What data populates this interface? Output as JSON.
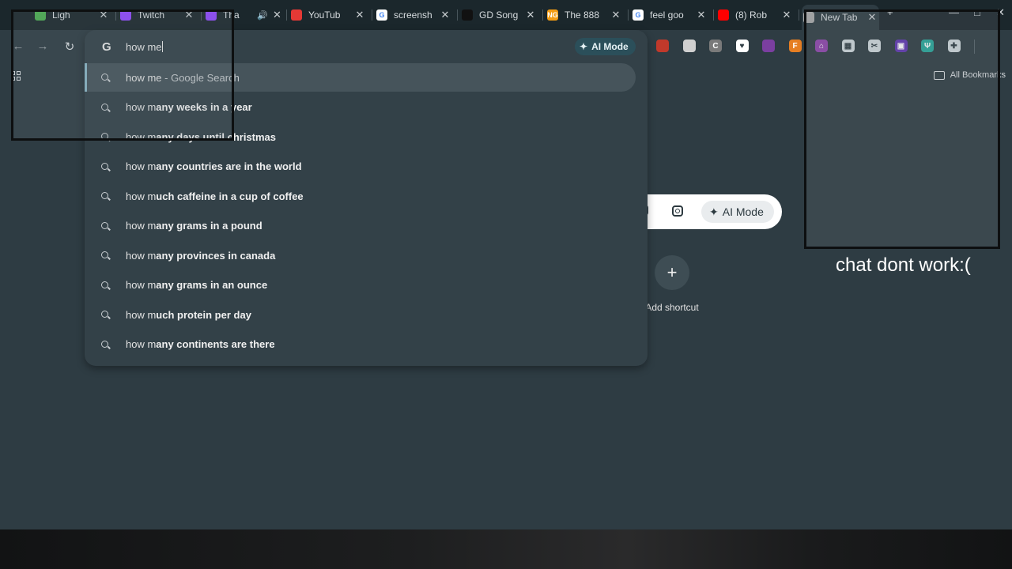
{
  "tabs": [
    {
      "title": "Ligh",
      "favicon_color": "#4caf50",
      "favicon_char": "",
      "audio": false
    },
    {
      "title": "Twitch",
      "favicon_color": "#9147ff",
      "favicon_char": "",
      "audio": false
    },
    {
      "title": "Tha",
      "favicon_color": "#9147ff",
      "favicon_char": "",
      "audio": true
    },
    {
      "title": "YouTub",
      "favicon_color": "#e53935",
      "favicon_char": "",
      "audio": false
    },
    {
      "title": "screensh",
      "favicon_color": "#ffffff",
      "favicon_char": "G",
      "audio": false
    },
    {
      "title": "GD Song",
      "favicon_color": "#111111",
      "favicon_char": "",
      "audio": false
    },
    {
      "title": "The 888",
      "favicon_color": "#f39c12",
      "favicon_char": "NG",
      "audio": false
    },
    {
      "title": "feel goo",
      "favicon_color": "#ffffff",
      "favicon_char": "G",
      "audio": false
    },
    {
      "title": "(8) Rob",
      "favicon_color": "#ff0000",
      "favicon_char": "",
      "audio": false
    },
    {
      "title": "New Tab",
      "favicon_color": "#aaaaaa",
      "favicon_char": "",
      "audio": false,
      "active": true
    }
  ],
  "omnibox": {
    "g_label": "G",
    "query": "how me",
    "ai_mode_label": "AI Mode"
  },
  "suggestions": [
    {
      "typed": "how me",
      "rest": "",
      "hint": " - Google Search",
      "selected": true
    },
    {
      "typed": "how m",
      "rest": "any weeks in a year",
      "hint": ""
    },
    {
      "typed": "how m",
      "rest": "any days until christmas",
      "hint": ""
    },
    {
      "typed": "how m",
      "rest": "any countries are in the world",
      "hint": ""
    },
    {
      "typed": "how m",
      "rest": "uch caffeine in a cup of coffee",
      "hint": ""
    },
    {
      "typed": "how m",
      "rest": "any grams in a pound",
      "hint": ""
    },
    {
      "typed": "how m",
      "rest": "any provinces in canada",
      "hint": ""
    },
    {
      "typed": "how m",
      "rest": "any grams in an ounce",
      "hint": ""
    },
    {
      "typed": "how m",
      "rest": "uch protein per day",
      "hint": ""
    },
    {
      "typed": "how m",
      "rest": "any continents are there",
      "hint": ""
    }
  ],
  "extensions": [
    {
      "name": "ext-red",
      "color": "#c0392b",
      "char": ""
    },
    {
      "name": "ext-circle",
      "color": "#d0d0d0",
      "char": ""
    },
    {
      "name": "ext-c",
      "color": "#7a7a7a",
      "char": "C"
    },
    {
      "name": "ext-heart",
      "color": "#ffffff",
      "char": "♥"
    },
    {
      "name": "ext-purple-ring",
      "color": "#7b3fa0",
      "char": ""
    },
    {
      "name": "ext-orange",
      "color": "#e67e22",
      "char": "F"
    },
    {
      "name": "ext-house",
      "color": "#8e44ad",
      "char": "⌂"
    },
    {
      "name": "ext-qr",
      "color": "#cfd8dc",
      "char": "▦"
    },
    {
      "name": "ext-scissors",
      "color": "#cfd8dc",
      "char": "✂"
    },
    {
      "name": "ext-video",
      "color": "#5e35b1",
      "char": "▣"
    },
    {
      "name": "ext-tree",
      "color": "#26a69a",
      "char": "Ψ"
    },
    {
      "name": "ext-puzzle",
      "color": "#cfd8dc",
      "char": "✚"
    }
  ],
  "bookmarks_label": "All Bookmarks",
  "ntp": {
    "ai_mode_label": "AI Mode",
    "add_shortcut_label": "Add shortcut",
    "plus": "+"
  },
  "overlay_note": "chat dont work:(",
  "icons": {
    "back": "←",
    "forward": "→",
    "reload": "↻",
    "close": "✕",
    "minimize": "—",
    "maximize": "□",
    "new_tab": "+",
    "audio": "🔊",
    "sparkle": "✦"
  }
}
